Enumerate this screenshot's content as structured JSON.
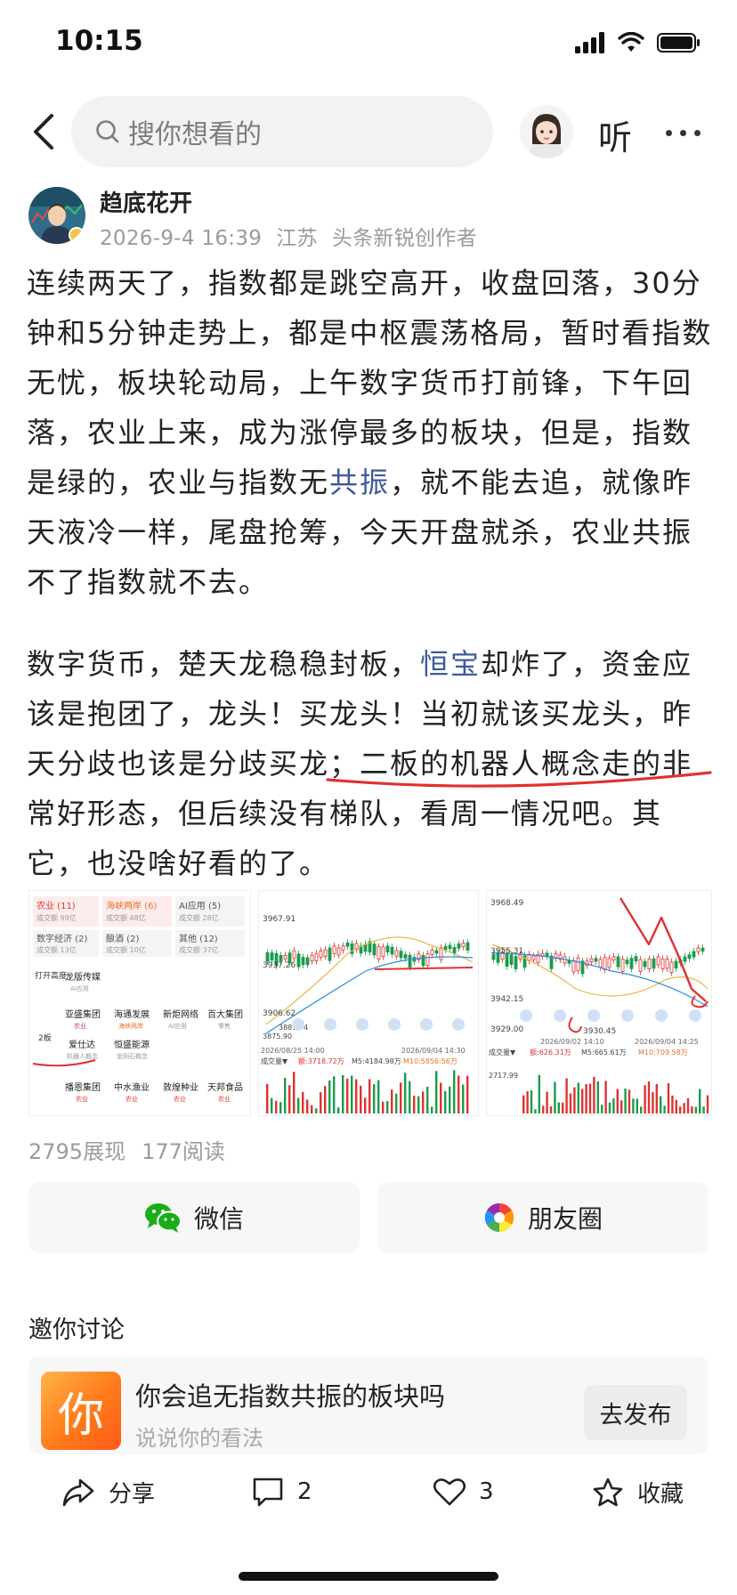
{
  "status": {
    "time": "10:15"
  },
  "nav": {
    "search_placeholder": "搜你想看的",
    "listen": "听"
  },
  "author": {
    "name": "趋底花开",
    "date": "2026-9-4 16:39",
    "location": "江苏",
    "badge": "头条新锐创作者"
  },
  "article": {
    "p1_a": "连续两天了，指数都是跳空高开，收盘回落，30分钟和5分钟走势上，都是中枢震荡格局，暂时看指数无忧，板块轮动局，上午数字货币打前锋，下午回落，农业上来，成为涨停最多的板块，但是，指数是绿的，农业与指数无",
    "p1_link": "共振",
    "p1_b": "，就不能去追，就像昨天液冷一样，尾盘抢筹，今天开盘就杀，农业共振不了指数就不去。",
    "p2_a": "数字货币，楚天龙稳稳封板，",
    "p2_link": "恒宝",
    "p2_b": "却炸了，资金应该是抱团了，龙头！买龙头！当初就该买龙头，昨天分歧也该是分歧买龙；",
    "p2_under": "二板的机器人概念走的非",
    "p2_c": "常好形态，但后续没有梯队，看周一情况吧。其它，也没啥好看的了。"
  },
  "images": {
    "img1": {
      "tags": [
        {
          "name": "农业 (11)",
          "sub": "成交额 99亿"
        },
        {
          "name": "海峡两岸 (6)",
          "sub": "成交额 48亿"
        },
        {
          "name": "AI应用 (5)",
          "sub": "成交额 28亿"
        },
        {
          "name": "数字经济 (2)",
          "sub": "成交额 13亿"
        },
        {
          "name": "酿酒 (2)",
          "sub": "成交额 10亿"
        },
        {
          "name": "其他 (12)",
          "sub": "成交额 37亿"
        }
      ],
      "row_labels": [
        "打开高度",
        "2板"
      ],
      "stocks": [
        {
          "name": "龙版传媒",
          "tag": "AI应用"
        },
        {
          "name": "亚盛集团",
          "tag": "农业"
        },
        {
          "name": "海通发展",
          "tag": "海峡两岸"
        },
        {
          "name": "新炬网络",
          "tag": "AI应用"
        },
        {
          "name": "百大集团",
          "tag": "零售"
        },
        {
          "name": "爱仕达",
          "tag": "机器人概念"
        },
        {
          "name": "恒盛能源",
          "tag": "金刚石概念"
        },
        {
          "name": "播恩集团",
          "tag": "农业"
        },
        {
          "name": "中水渔业",
          "tag": "农业"
        },
        {
          "name": "敦煌种业",
          "tag": "农业"
        },
        {
          "name": "天邦食品",
          "tag": "农业"
        }
      ]
    },
    "img2": {
      "prices": [
        "3967.91",
        "3937.26",
        "3906.62",
        "3881.74",
        "3875.90"
      ],
      "date_left": "2026/08/25 14:00",
      "date_right": "2026/09/04 14:30",
      "vol_label": "成交量▼",
      "vol": "额:3718.72万",
      "ma5": "M5:4184.98万",
      "ma10": "M10:5856.56万"
    },
    "img3": {
      "prices": [
        "3968.49",
        "3955.31",
        "3942.15",
        "3929.00"
      ],
      "low": "3930.45",
      "date_left": "2026/09/02 14:10",
      "date_right": "2026/09/04 14:25",
      "vol_label": "成交量▼",
      "vol": "额:626.31万",
      "ma5": "M5:665.61万",
      "ma10": "M10:709.58万",
      "vol_axis": "2717.99"
    }
  },
  "stats": {
    "views": "2795展现",
    "reads": "177阅读"
  },
  "share": {
    "wechat": "微信",
    "moments": "朋友圈"
  },
  "discussion": {
    "title": "邀你讨论",
    "tile": "你",
    "question": "你会追无指数共振的板块吗",
    "placeholder": "说说你的看法",
    "button": "去发布"
  },
  "bottom": {
    "share": "分享",
    "comments": "2",
    "likes": "3",
    "favorite": "收藏"
  },
  "colors": {
    "link": "#3d5a9a",
    "red": "#e03131",
    "green": "#1aad19"
  }
}
